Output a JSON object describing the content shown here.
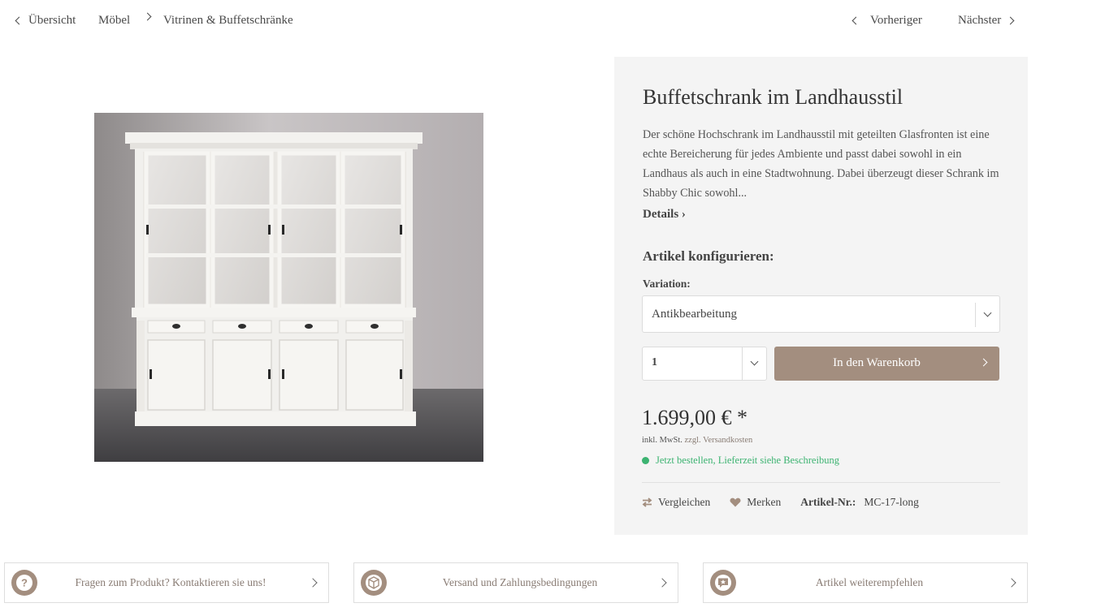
{
  "breadcrumb": {
    "overview": "Übersicht",
    "category": "Möbel",
    "subcategory": "Vitrinen & Buffetschränke"
  },
  "pager": {
    "previous": "Vorheriger",
    "next": "Nächster"
  },
  "product": {
    "title": "Buffetschrank im Landhausstil",
    "description": "Der schöne Hochschrank im Landhausstil mit geteilten Glasfronten ist eine echte Bereicherung für jedes Ambiente und passt dabei sowohl in ein Landhaus als auch in eine Stadtwohnung. Dabei überzeugt dieser Schrank im Shabby Chic sowohl...",
    "details_link": "Details ›",
    "image_icon": "white-buffet-cabinet-photo"
  },
  "config": {
    "heading": "Artikel konfigurieren:",
    "variation_label": "Variation:",
    "variation_value": "Antikbearbeitung",
    "quantity_value": "1",
    "add_to_cart": "In den Warenkorb"
  },
  "pricing": {
    "price": "1.699,00 € *",
    "tax_note": "inkl. MwSt.",
    "shipping_link": "zzgl. Versandkosten",
    "delivery": "Jetzt bestellen, Lieferzeit siehe Beschreibung"
  },
  "actions": {
    "compare": "Vergleichen",
    "remember": "Merken",
    "article_no_label": "Artikel-Nr.:",
    "article_no_value": "MC-17-long"
  },
  "info_boxes": [
    {
      "label": "Fragen zum Produkt? Kontaktieren sie uns!",
      "icon": "question-icon"
    },
    {
      "label": "Versand und Zahlungsbedingungen",
      "icon": "package-icon"
    },
    {
      "label": "Artikel weiterempfehlen",
      "icon": "recommend-icon"
    }
  ],
  "colors": {
    "accent": "#a38e7f",
    "panel_bg": "#f4f4f4",
    "success": "#3cb371"
  }
}
